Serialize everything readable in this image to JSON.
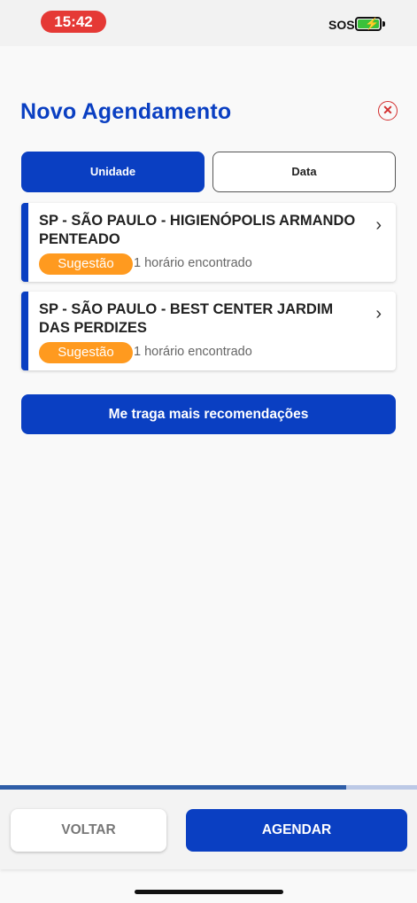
{
  "status_bar": {
    "time": "15:42",
    "carrier": "SOS",
    "battery_bolt": "⚡"
  },
  "header": {
    "title": "Novo Agendamento",
    "close_glyph": "✕"
  },
  "tabs": [
    {
      "label": "Unidade",
      "active": true
    },
    {
      "label": "Data",
      "active": false
    }
  ],
  "units": [
    {
      "name": "SP - SÃO PAULO - HIGIENÓPOLIS ARMANDO PENTEADO",
      "badge": "Sugestão",
      "availability": "1 horário encontrado",
      "chevron": "›"
    },
    {
      "name": "SP - SÃO PAULO - BEST CENTER JARDIM DAS PERDIZES",
      "badge": "Sugestão",
      "availability": "1 horário encontrado",
      "chevron": "›"
    }
  ],
  "more_button": {
    "label": "Me traga mais recomendações"
  },
  "progress": {
    "fraction": 0.83
  },
  "footer": {
    "back_label": "VOLTAR",
    "submit_label": "AGENDAR"
  },
  "colors": {
    "primary": "#0a3fc2",
    "accent": "#ff9a1f",
    "danger": "#d32f2f"
  },
  "icons": {
    "close": "close-icon",
    "chevron": "chevron-right-icon",
    "battery": "battery-charging-icon"
  }
}
